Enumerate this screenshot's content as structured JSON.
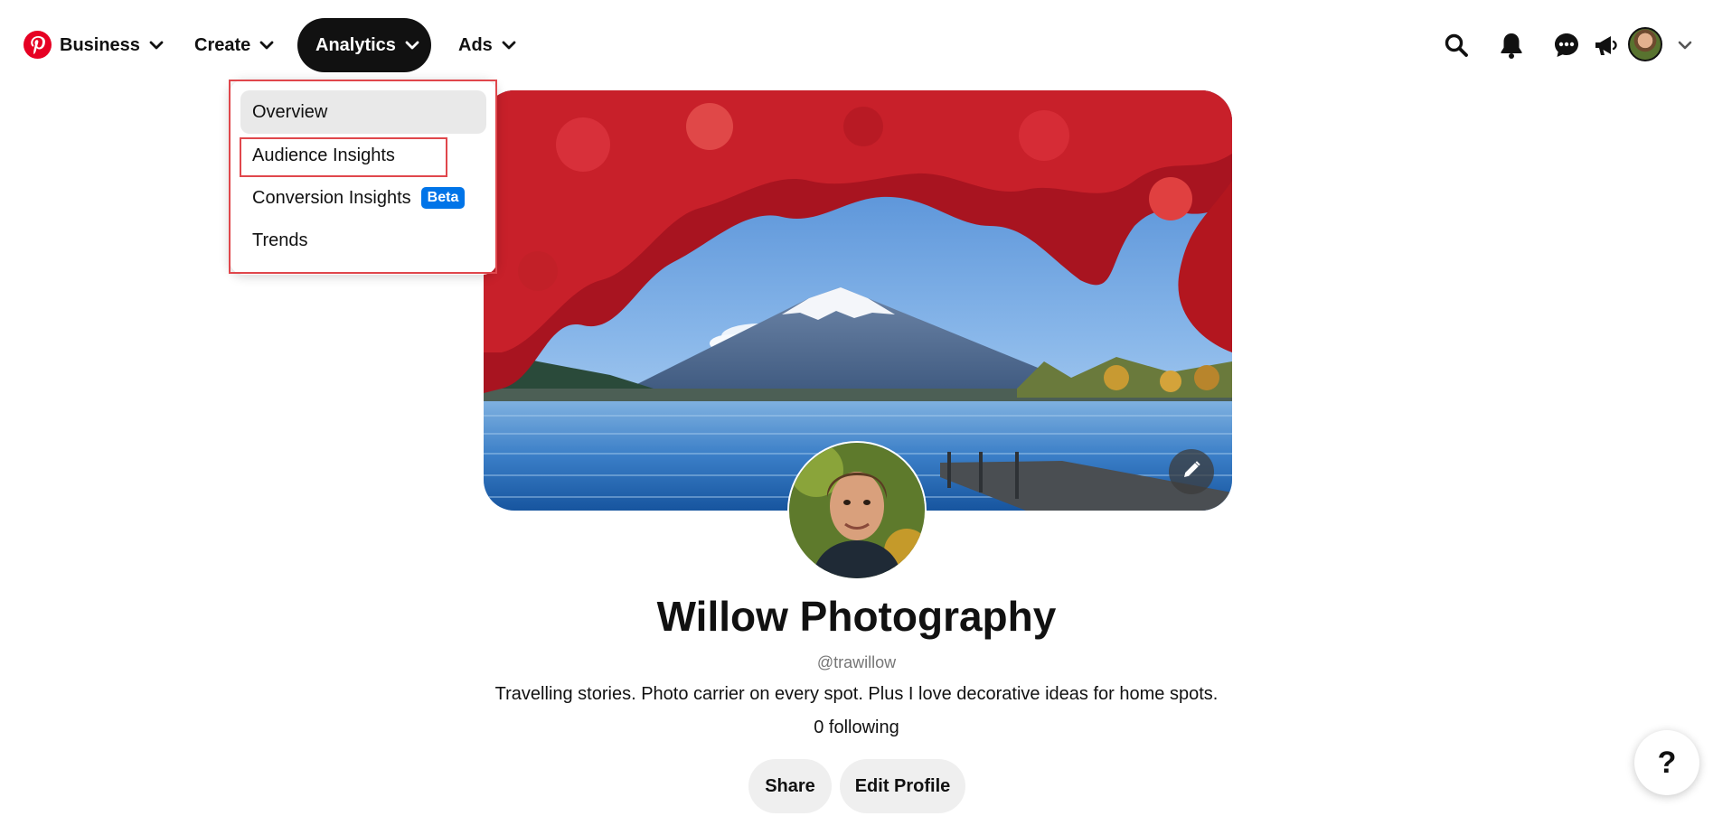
{
  "nav": {
    "brand_icon": "pinterest-logo",
    "items": [
      {
        "label": "Business",
        "icon": "chevron-down-icon"
      },
      {
        "label": "Create",
        "icon": "chevron-down-icon"
      },
      {
        "label": "Analytics",
        "icon": "chevron-down-icon",
        "state": "open"
      },
      {
        "label": "Ads",
        "icon": "chevron-down-icon"
      }
    ],
    "right_icons": [
      "search-icon",
      "bell-icon",
      "messages-icon",
      "megaphone-icon",
      "avatar",
      "chevron-down-icon"
    ]
  },
  "analytics_menu": {
    "items": [
      {
        "label": "Overview",
        "state": "hovered"
      },
      {
        "label": "Audience Insights",
        "state": "highlighted"
      },
      {
        "label": "Conversion Insights",
        "badge": "Beta"
      },
      {
        "label": "Trends"
      }
    ]
  },
  "profile": {
    "display_name": "Willow Photography",
    "username": "@trawillow",
    "bio": "Travelling stories. Photo carrier on every spot. Plus I love decorative ideas for home spots.",
    "following": "0 following",
    "share_label": "Share",
    "edit_label": "Edit Profile",
    "cover_edit_icon": "pencil-icon"
  },
  "help": {
    "label": "?"
  },
  "colors": {
    "brand": "#e60023",
    "active_nav_bg": "#111111",
    "beta_badge": "#0074e8",
    "annotation_outline": "#e0474c",
    "button_bg": "#efefef"
  }
}
